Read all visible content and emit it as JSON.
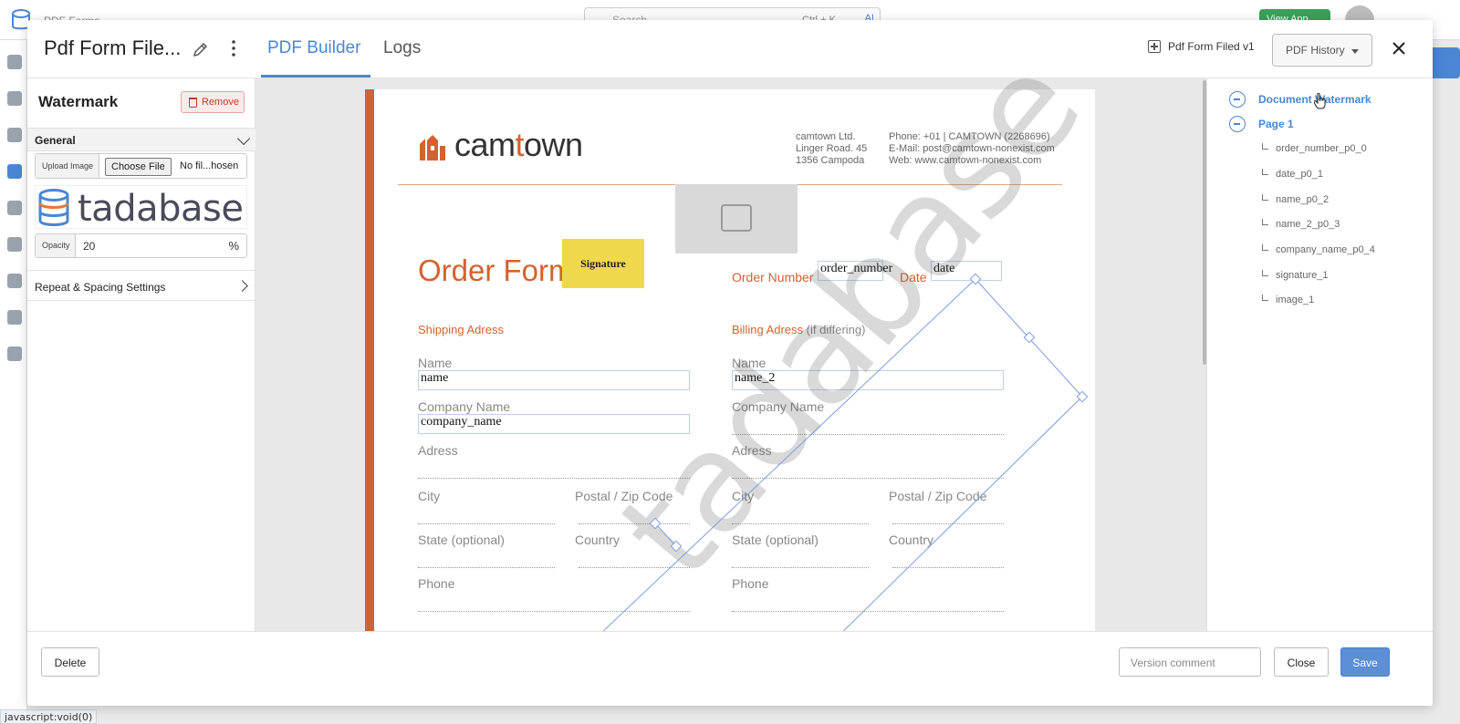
{
  "app": {
    "breadcrumb": "PDF Forms",
    "search_placeholder": "Search",
    "search_shortcut": "Ctrl + K",
    "ai_label": "AI",
    "view_app_label": "View App",
    "status_bar": "javascript:void(0)"
  },
  "modal": {
    "title": "Pdf Form File...",
    "tabs": [
      {
        "label": "PDF Builder",
        "active": true
      },
      {
        "label": "Logs",
        "active": false
      }
    ],
    "version_label": "Pdf Form Filed v1",
    "history_label": "PDF History"
  },
  "left_panel": {
    "title": "Watermark",
    "remove_label": "Remove",
    "general_label": "General",
    "upload_label": "Upload Image",
    "choose_file_label": "Choose File",
    "no_file_label": "No fil...hosen",
    "logo_text": "tadabase",
    "opacity_label": "Opacity",
    "opacity_value": "20",
    "opacity_unit": "%",
    "repeat_label": "Repeat & Spacing Settings"
  },
  "pdf_page": {
    "brand_left": "cam",
    "brand_o": "t",
    "brand_right": "own",
    "company_lines": [
      "camtown Ltd.",
      "Linger Road. 45",
      "1356 Campoda"
    ],
    "contact_lines": [
      "Phone: +01 | CAMTOWN (2268696)",
      "E-Mail: post@camtown-nonexist.com",
      "Web: www.camtown-nonexist.com"
    ],
    "heading": "Order Form",
    "signature_label": "Signature",
    "order_number_label": "Order Number",
    "order_number_field": "order_number",
    "date_label": "Date",
    "date_field": "date",
    "shipping_label": "Shipping Adress",
    "billing_label": "Billing Adress",
    "billing_note": "(if differing)",
    "name_label": "Name",
    "name_field": "name",
    "name2_field": "name_2",
    "company_label": "Company Name",
    "company_field": "company_name",
    "adress_label": "Adress",
    "city_label": "City",
    "postal_label": "Postal / Zip Code",
    "state_label": "State (optional)",
    "country_label": "Country",
    "phone_label": "Phone",
    "watermark_text": "tadabase"
  },
  "tree": {
    "document_watermark": "Document Watermark",
    "page1": "Page 1",
    "children": [
      "order_number_p0_0",
      "date_p0_1",
      "name_p0_2",
      "name_2_p0_3",
      "company_name_p0_4",
      "signature_1",
      "image_1"
    ]
  },
  "footer": {
    "delete_label": "Delete",
    "version_comment_placeholder": "Version comment",
    "close_label": "Close",
    "save_label": "Save"
  },
  "colors": {
    "accent": "#4a86d4",
    "brand_orange": "#d4622e",
    "signature_yellow": "#f0d84c"
  }
}
